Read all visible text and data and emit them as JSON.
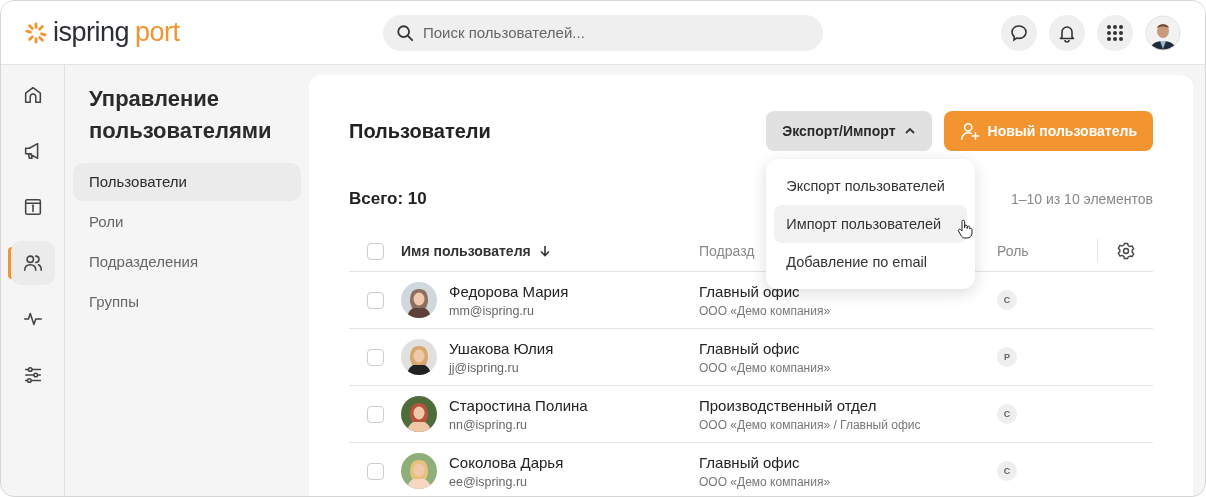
{
  "header": {
    "logo": {
      "brand": "ispring",
      "product": "port"
    },
    "search": {
      "placeholder": "Поиск пользователей..."
    }
  },
  "nav_rail": [
    {
      "kind": "home",
      "selected": false
    },
    {
      "kind": "megaphone",
      "selected": false
    },
    {
      "kind": "info",
      "selected": false
    },
    {
      "kind": "users",
      "selected": true
    },
    {
      "kind": "activity",
      "selected": false
    },
    {
      "kind": "sliders",
      "selected": false
    }
  ],
  "sidebar": {
    "title": "Управление пользователями",
    "items": [
      {
        "label": "Пользователи",
        "selected": true
      },
      {
        "label": "Роли",
        "selected": false
      },
      {
        "label": "Подразделения",
        "selected": false
      },
      {
        "label": "Группы",
        "selected": false
      }
    ]
  },
  "page": {
    "title": "Пользователи",
    "export_button": {
      "label": "Экспорт/Импорт",
      "expanded": true
    },
    "new_button": {
      "label": "Новый пользователь"
    },
    "menu": [
      {
        "label": "Экспорт пользователей",
        "highlighted": false
      },
      {
        "label": "Импорт пользователей",
        "highlighted": true
      },
      {
        "label": "Добавление по email",
        "highlighted": false
      }
    ],
    "total": "Всего: 10",
    "range": "1–10 из 10 элементов",
    "table": {
      "select_all_checked": false,
      "columns": [
        "Имя пользователя",
        "Подразд",
        "Роль"
      ],
      "rows": [
        {
          "checked": false,
          "name": "Федорова Мария",
          "email": "mm@ispring.ru",
          "department": "Главный офис",
          "path": "ООО «Демо компания»",
          "role": "С"
        },
        {
          "checked": false,
          "name": "Ушакова Юлия",
          "email": "jj@ispring.ru",
          "department": "Главный офис",
          "path": "ООО «Демо компания»",
          "role": "Р"
        },
        {
          "checked": false,
          "name": "Старостина Полина",
          "email": "nn@ispring.ru",
          "department": "Производственный отдел",
          "path": "ООО «Демо компания» / Главный офис",
          "role": "С"
        },
        {
          "checked": false,
          "name": "Соколова Дарья",
          "email": "ee@ispring.ru",
          "department": "Главный офис",
          "path": "ООО «Демо компания»",
          "role": "С"
        }
      ]
    }
  }
}
